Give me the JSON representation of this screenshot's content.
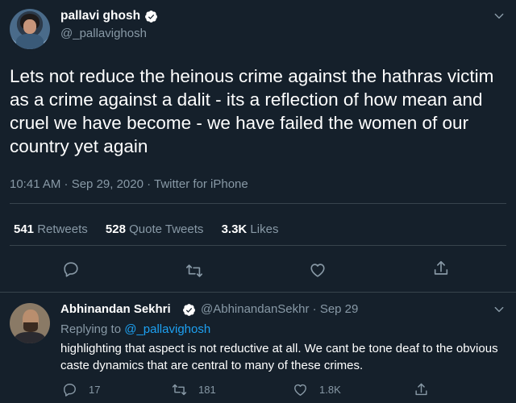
{
  "tweet": {
    "author_name": "pallavi ghosh",
    "author_handle": "@_pallavighosh",
    "text": "Lets not reduce the heinous crime against the hathras victim as a crime against a dalit - its a reflection of how mean and cruel we have become - we have failed the women of our country yet again",
    "timestamp": "10:41 AM · Sep 29, 2020 · Twitter for iPhone",
    "stats": {
      "retweets_count": "541",
      "retweets_label": "Retweets",
      "quote_count": "528",
      "quote_label": "Quote Tweets",
      "likes_count": "3.3K",
      "likes_label": "Likes"
    }
  },
  "reply": {
    "author_name": "Abhinandan Sekhri",
    "author_handle_date": "@AbhinandanSekhr · Sep 29",
    "replying_prefix": "Replying to",
    "replying_to": "@_pallavighosh",
    "text": "highlighting that aspect is not reductive at all. We cant be tone deaf to the obvious caste dynamics that are central to many of these crimes.",
    "reply_count": "17",
    "retweet_count": "181",
    "like_count": "1.8K"
  },
  "icons": [
    "verified-badge-icon",
    "chevron-down-icon",
    "reply-icon",
    "retweet-icon",
    "like-icon",
    "share-icon"
  ],
  "colors": {
    "background": "#15202b",
    "primary_text": "#ffffff",
    "secondary_text": "#8899a6",
    "accent": "#1da1f2",
    "divider": "#38444d"
  }
}
